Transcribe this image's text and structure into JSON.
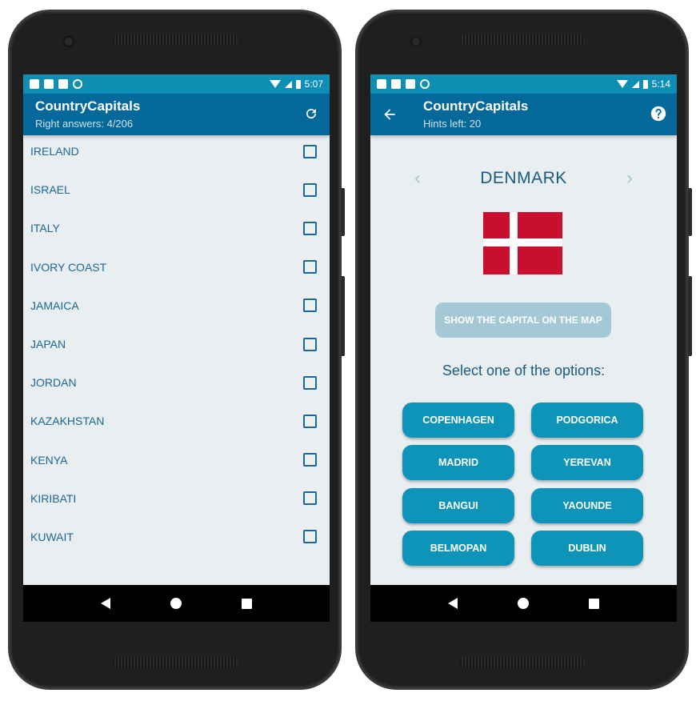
{
  "left_phone": {
    "status": {
      "time": "5:07"
    },
    "app_bar": {
      "title": "CountryCapitals",
      "subtitle": "Right answers: 4/206"
    },
    "list": [
      {
        "label": "IRELAND",
        "checked": false
      },
      {
        "label": "ISRAEL",
        "checked": false
      },
      {
        "label": "ITALY",
        "checked": false
      },
      {
        "label": "IVORY COAST",
        "checked": false
      },
      {
        "label": "JAMAICA",
        "checked": false
      },
      {
        "label": "JAPAN",
        "checked": false
      },
      {
        "label": "JORDAN",
        "checked": false
      },
      {
        "label": "KAZAKHSTAN",
        "checked": false
      },
      {
        "label": "KENYA",
        "checked": false
      },
      {
        "label": "KIRIBATI",
        "checked": false
      },
      {
        "label": "KUWAIT",
        "checked": false
      }
    ]
  },
  "right_phone": {
    "status": {
      "time": "5:14"
    },
    "app_bar": {
      "title": "CountryCapitals",
      "subtitle": "Hints left: 20"
    },
    "country": "DENMARK",
    "chevron_left": "‹",
    "chevron_right": "›",
    "map_button": "SHOW THE CAPITAL ON THE MAP",
    "prompt": "Select one of the options:",
    "options": [
      "COPENHAGEN",
      "PODGORICA",
      "MADRID",
      "YEREVAN",
      "BANGUI",
      "YAOUNDE",
      "BELMOPAN",
      "DUBLIN"
    ]
  },
  "colors": {
    "status_bar": "#0f8eb4",
    "app_bar": "#05689a",
    "accent": "#0e94b8",
    "text": "#1b6797",
    "screen_bg": "#e9eef0",
    "flag_red": "#c8102e"
  },
  "icons": [
    "refresh-icon",
    "back-arrow-icon",
    "help-icon",
    "wifi-icon",
    "signal-icon",
    "battery-icon"
  ]
}
